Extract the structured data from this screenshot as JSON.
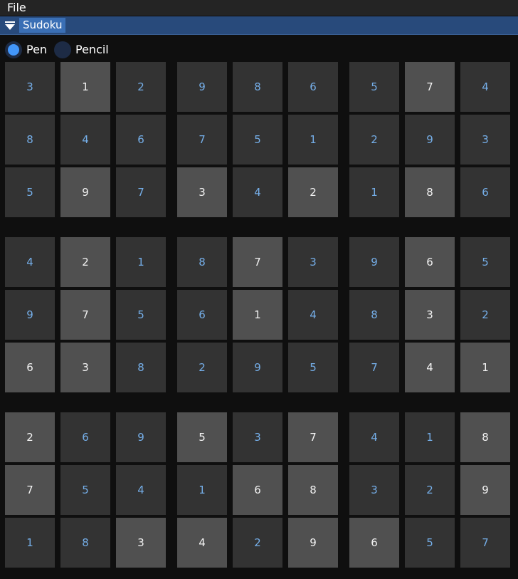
{
  "menu": {
    "file_label": "File"
  },
  "header": {
    "title": "Sudoku"
  },
  "modes": {
    "pen_label": "Pen",
    "pencil_label": "Pencil",
    "selected": "pen"
  },
  "colors": {
    "background": "#0f0f0f",
    "header_bar": "#284a7b",
    "title_highlight": "#3a6fb5",
    "radio_active": "#4296fa",
    "given_cell": "#505050",
    "entered_cell": "#333333",
    "given_digit": "#f2f2f2",
    "entered_digit": "#75aee8"
  },
  "board": {
    "values": [
      [
        3,
        1,
        2,
        9,
        8,
        6,
        5,
        7,
        4
      ],
      [
        8,
        4,
        6,
        7,
        5,
        1,
        2,
        9,
        3
      ],
      [
        5,
        9,
        7,
        3,
        4,
        2,
        1,
        8,
        6
      ],
      [
        4,
        2,
        1,
        8,
        7,
        3,
        9,
        6,
        5
      ],
      [
        9,
        7,
        5,
        6,
        1,
        4,
        8,
        3,
        2
      ],
      [
        6,
        3,
        8,
        2,
        9,
        5,
        7,
        4,
        1
      ],
      [
        2,
        6,
        9,
        5,
        3,
        7,
        4,
        1,
        8
      ],
      [
        7,
        5,
        4,
        1,
        6,
        8,
        3,
        2,
        9
      ],
      [
        1,
        8,
        3,
        4,
        2,
        9,
        6,
        5,
        7
      ]
    ],
    "given": [
      [
        0,
        1,
        0,
        0,
        0,
        0,
        0,
        1,
        0
      ],
      [
        0,
        0,
        0,
        0,
        0,
        0,
        0,
        0,
        0
      ],
      [
        0,
        1,
        0,
        1,
        0,
        1,
        0,
        1,
        0
      ],
      [
        0,
        1,
        0,
        0,
        1,
        0,
        0,
        1,
        0
      ],
      [
        0,
        1,
        0,
        0,
        1,
        0,
        0,
        1,
        0
      ],
      [
        1,
        1,
        0,
        0,
        0,
        0,
        0,
        1,
        1
      ],
      [
        1,
        0,
        0,
        1,
        0,
        1,
        0,
        0,
        1
      ],
      [
        1,
        0,
        0,
        0,
        1,
        1,
        0,
        0,
        1
      ],
      [
        0,
        0,
        1,
        1,
        0,
        1,
        1,
        0,
        0
      ]
    ]
  }
}
